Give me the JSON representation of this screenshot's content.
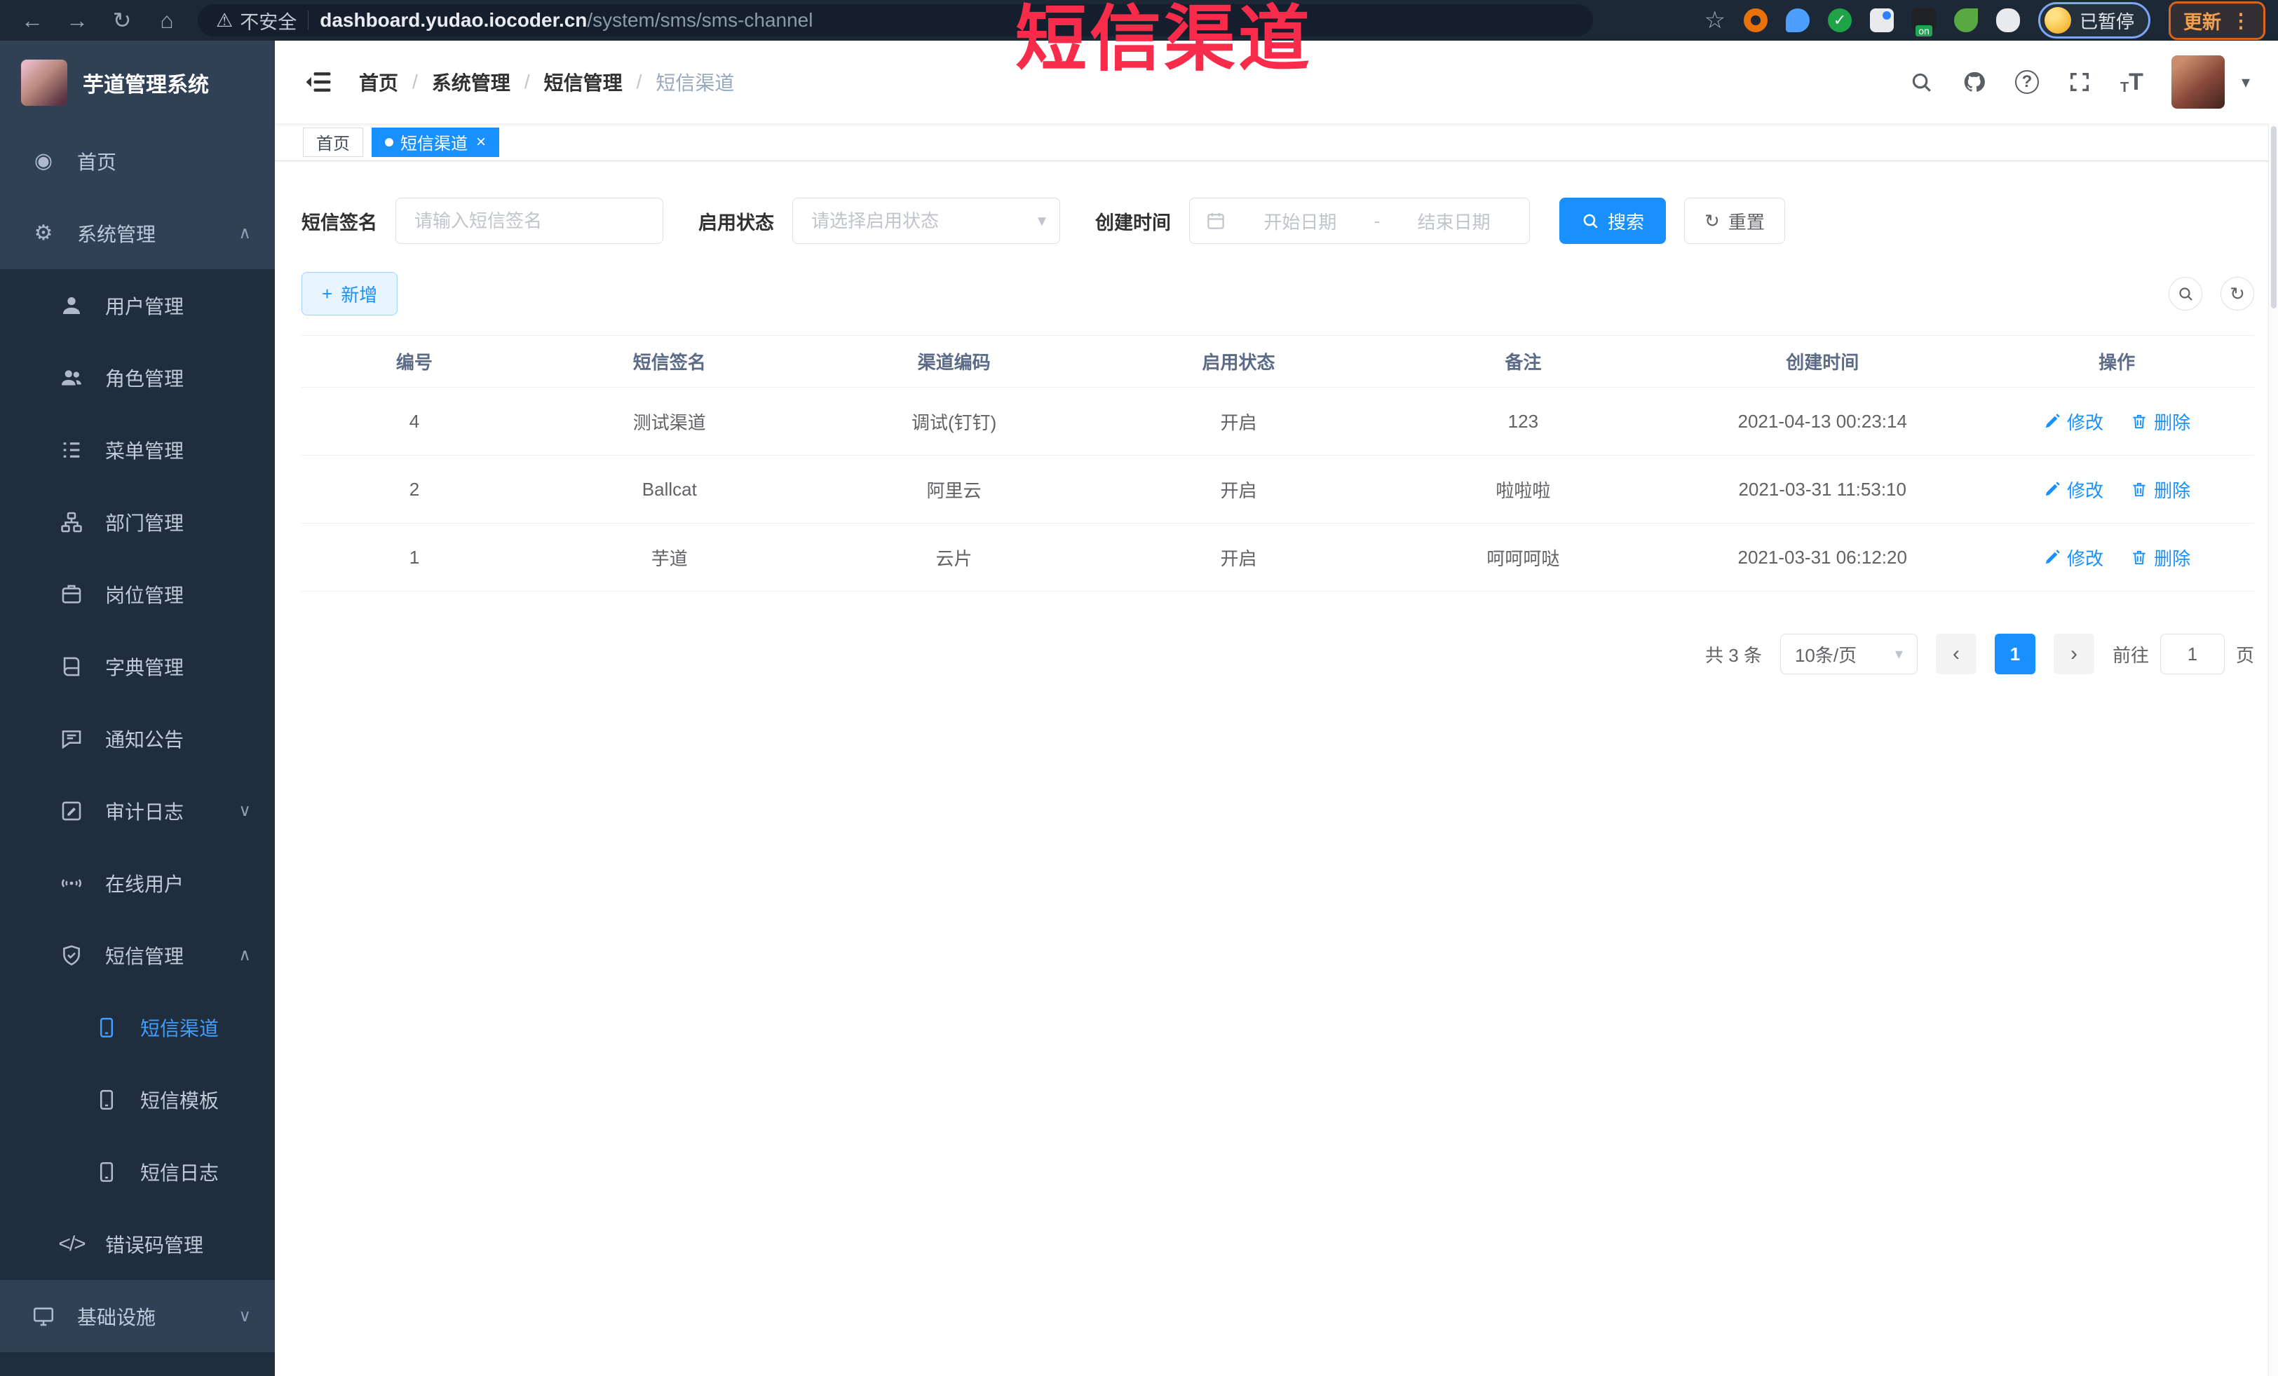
{
  "browser": {
    "security_label": "不安全",
    "url_domain": "dashboard.yudao.iocoder.cn",
    "url_path": "/system/sms/sms-channel",
    "extension_badge": "on",
    "paused_label": "已暂停",
    "update_label": "更新"
  },
  "annotation": {
    "text": "短信渠道"
  },
  "sidebar": {
    "logo_title": "芋道管理系统",
    "items": [
      {
        "label": "首页",
        "icon": "dashboard-icon"
      },
      {
        "label": "系统管理",
        "icon": "gear-icon",
        "state": "expanded"
      },
      {
        "label": "用户管理",
        "icon": "user-icon"
      },
      {
        "label": "角色管理",
        "icon": "peoples-icon"
      },
      {
        "label": "菜单管理",
        "icon": "menu-list-icon"
      },
      {
        "label": "部门管理",
        "icon": "tree-icon"
      },
      {
        "label": "岗位管理",
        "icon": "post-icon"
      },
      {
        "label": "字典管理",
        "icon": "dictionary-icon"
      },
      {
        "label": "通知公告",
        "icon": "message-icon"
      },
      {
        "label": "审计日志",
        "icon": "log-icon",
        "state": "collapsed"
      },
      {
        "label": "在线用户",
        "icon": "online-icon"
      },
      {
        "label": "短信管理",
        "icon": "shield-icon",
        "state": "expanded"
      },
      {
        "label": "短信渠道",
        "icon": "phone-icon",
        "active": true
      },
      {
        "label": "短信模板",
        "icon": "phone-icon"
      },
      {
        "label": "短信日志",
        "icon": "phone-icon"
      },
      {
        "label": "错误码管理",
        "icon": "code-icon"
      },
      {
        "label": "基础设施",
        "icon": "monitor-icon",
        "state": "collapsed"
      }
    ]
  },
  "header": {
    "breadcrumb": [
      "首页",
      "系统管理",
      "短信管理",
      "短信渠道"
    ]
  },
  "tabs": [
    {
      "label": "首页",
      "active": false
    },
    {
      "label": "短信渠道",
      "active": true
    }
  ],
  "filters": {
    "sign_label": "短信签名",
    "sign_placeholder": "请输入短信签名",
    "status_label": "启用状态",
    "status_placeholder": "请选择启用状态",
    "time_label": "创建时间",
    "date_start": "开始日期",
    "date_separator": "-",
    "date_end": "结束日期",
    "search_label": "搜索",
    "reset_label": "重置"
  },
  "toolbar": {
    "add_label": "新增"
  },
  "table": {
    "headers": [
      "编号",
      "短信签名",
      "渠道编码",
      "启用状态",
      "备注",
      "创建时间",
      "操作"
    ],
    "edit_label": "修改",
    "delete_label": "删除",
    "rows": [
      {
        "id": "4",
        "sign": "测试渠道",
        "code": "调试(钉钉)",
        "status": "开启",
        "remark": "123",
        "created": "2021-04-13 00:23:14"
      },
      {
        "id": "2",
        "sign": "Ballcat",
        "code": "阿里云",
        "status": "开启",
        "remark": "啦啦啦",
        "created": "2021-03-31 11:53:10"
      },
      {
        "id": "1",
        "sign": "芋道",
        "code": "云片",
        "status": "开启",
        "remark": "呵呵呵哒",
        "created": "2021-03-31 06:12:20"
      }
    ]
  },
  "pagination": {
    "total_label": "共 3 条",
    "page_size_label": "10条/页",
    "current_page": "1",
    "goto_label": "前往",
    "goto_value": "1",
    "page_unit": "页"
  },
  "icons": {
    "warning": "⚠",
    "back": "←",
    "forward": "→",
    "reload": "↻",
    "home": "⌂",
    "star": "☆",
    "menu_dots": "⋮",
    "caret_down": "▾",
    "chevron_up": "∧",
    "chevron_down": "∨",
    "prev": "‹",
    "next": "›",
    "plus": "+",
    "gear": "⚙",
    "dashboard": "◉",
    "code": "</>",
    "close": "×",
    "question": "?",
    "refresh": "↻",
    "text_small": "T",
    "text_big": "T"
  },
  "colors": {
    "accent": "#1890ff",
    "sidebar_bg": "#304156",
    "submenu_bg": "#1f2d3d",
    "sidebar_active": "#409eff",
    "annotation_red": "#f92b4b",
    "browser_bar": "#1d2836"
  }
}
